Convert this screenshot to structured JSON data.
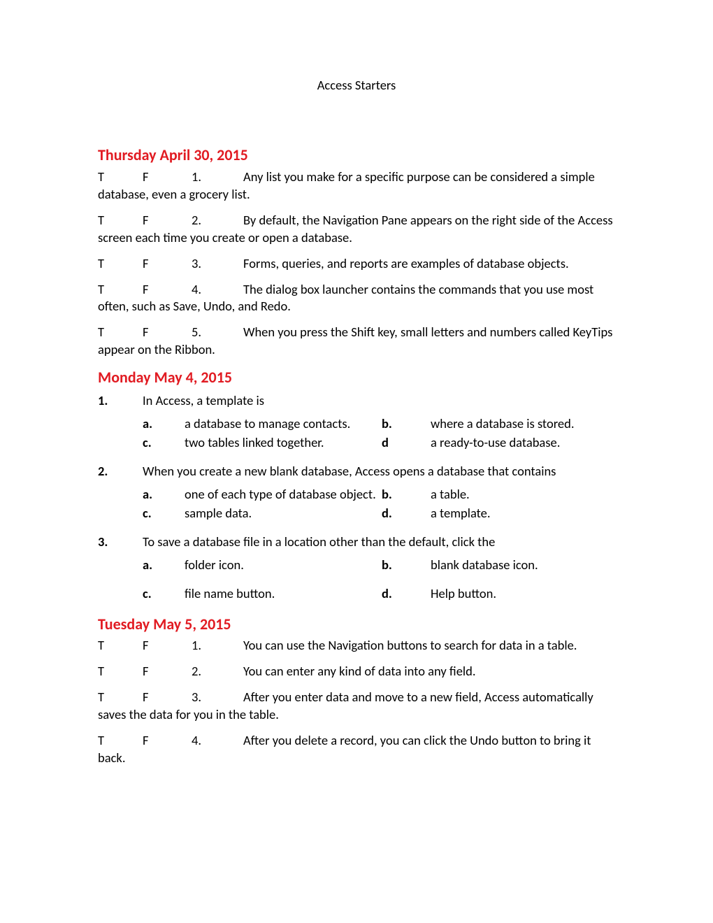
{
  "title": "Access Starters",
  "sections": [
    {
      "heading": "Thursday April 30, 2015",
      "tf": [
        {
          "t": "T",
          "f": "F",
          "n": "1.",
          "text": "Any list you make for a specific purpose can be considered a simple database, even a grocery list."
        },
        {
          "t": "T",
          "f": "F",
          "n": "2.",
          "text": "By default, the Navigation Pane appears on the right side of the Access screen each time you create or open a database."
        },
        {
          "t": "T",
          "f": "F",
          "n": "3.",
          "text": "Forms, queries, and reports are examples of database objects."
        },
        {
          "t": "T",
          "f": "F",
          "n": "4.",
          "text": "The dialog box launcher contains the commands that you use most often, such as Save, Undo, and Redo."
        },
        {
          "t": "T",
          "f": "F",
          "n": "5.",
          "text": "When you press the Shift key, small letters and numbers called KeyTips appear on the Ribbon."
        }
      ]
    },
    {
      "heading": "Monday May 4, 2015",
      "mc": [
        {
          "n": "1.",
          "q": "In Access, a template is",
          "a": "a database to manage contacts.",
          "b": "where a database is stored.",
          "al": "a.",
          "bl": "b.",
          "c": "two tables linked together.",
          "d": "a ready-to-use database.",
          "cl": "c.",
          "dl": "d"
        },
        {
          "n": "2.",
          "q": "When you create a new blank database, Access opens a database that contains",
          "a": "one of each type of database object.",
          "b": "a table.",
          "al": "a.",
          "bl": "b.",
          "c": "sample data.",
          "d": "a template.",
          "cl": "c.",
          "dl": "d."
        },
        {
          "n": "3.",
          "q": "To save a database file in a location other than the default, click the",
          "a": "folder icon.",
          "b": "blank database icon.",
          "al": "a.",
          "bl": "b.",
          "c": "file name button.",
          "d": "Help button.",
          "cl": "c.",
          "dl": "d.",
          "loose": true
        }
      ]
    },
    {
      "heading": "Tuesday May 5, 2015",
      "tf": [
        {
          "t": "T",
          "f": "F",
          "n": "1.",
          "text": "You can use the Navigation buttons to search for data in a table."
        },
        {
          "t": "T",
          "f": "F",
          "n": "2.",
          "text": "You can enter any kind of data into any field."
        },
        {
          "t": "T",
          "f": "F",
          "n": "3.",
          "text": "After you enter data and move to a new field, Access automatically saves the data for you in the table."
        },
        {
          "t": "T",
          "f": "F",
          "n": "4.",
          "text": "After you delete a record, you can click the Undo button to bring it back."
        }
      ]
    }
  ]
}
